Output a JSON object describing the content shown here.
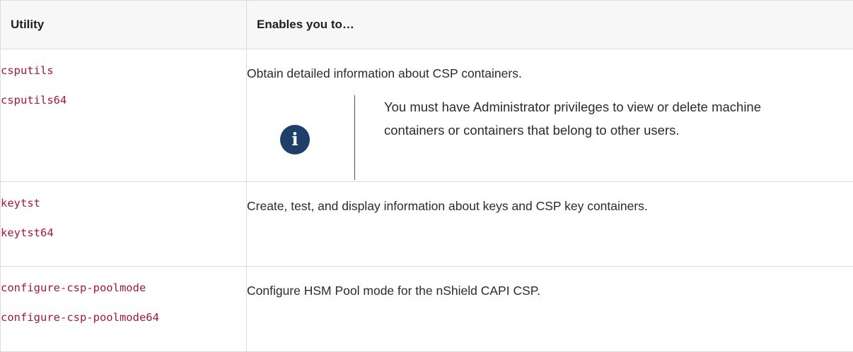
{
  "table": {
    "headers": {
      "utility": "Utility",
      "enables": "Enables you to…"
    },
    "rows": [
      {
        "commands": [
          "csputils",
          "csputils64"
        ],
        "description": "Obtain detailed information about CSP containers.",
        "note": {
          "icon": "info-icon",
          "text": "You must have Administrator privileges to view or delete machine containers or containers that belong to other users."
        }
      },
      {
        "commands": [
          "keytst",
          "keytst64"
        ],
        "description": "Create, test, and display information about keys and CSP key containers."
      },
      {
        "commands": [
          "configure-csp-poolmode",
          "configure-csp-poolmode64"
        ],
        "description": "Configure HSM Pool mode for the nShield CAPI CSP."
      }
    ]
  },
  "colors": {
    "command_text": "#a4173f",
    "info_icon_bg": "#1f3f6b",
    "note_bar": "#7a3a63",
    "header_bg": "#f7f7f7",
    "border": "#dcdcdc"
  }
}
